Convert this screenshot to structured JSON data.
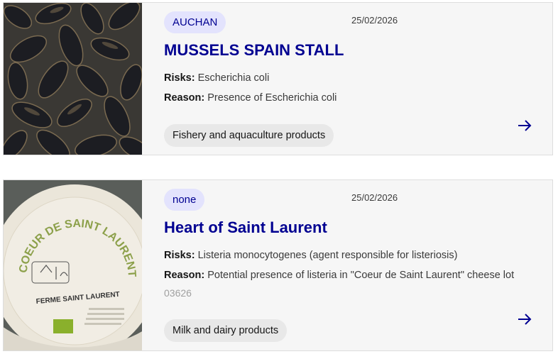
{
  "cards": [
    {
      "brand": "AUCHAN",
      "date": "25/02/2026",
      "title": "MUSSELS SPAIN STALL",
      "risks_label": "Risks:",
      "risks": "Escherichia coli",
      "reason_label": "Reason:",
      "reason": "Presence of Escherichia coli",
      "category": "Fishery and aquaculture products",
      "image": "mussels-photo"
    },
    {
      "brand": "none",
      "date": "25/02/2026",
      "title": "Heart of Saint Laurent",
      "risks_label": "Risks:",
      "risks": "Listeria monocytogenes (agent responsible for listeriosis)",
      "reason_label": "Reason:",
      "reason": "Potential presence of listeria in \"Coeur de Saint Laurent\" cheese lot",
      "reason_overflow": "03626",
      "category": "Milk and dairy products",
      "image": "cheese-package-photo",
      "package": {
        "arc_text": "COEUR DE SAINT LAURENT",
        "farm": "FERME SAINT LAURENT"
      }
    }
  ],
  "icons": {
    "open": "arrow-right-icon"
  },
  "colors": {
    "accent": "#000091",
    "card_bg": "#f6f6f6",
    "tag_bg": "#e3e3fd",
    "category_bg": "#e8e8e8"
  }
}
